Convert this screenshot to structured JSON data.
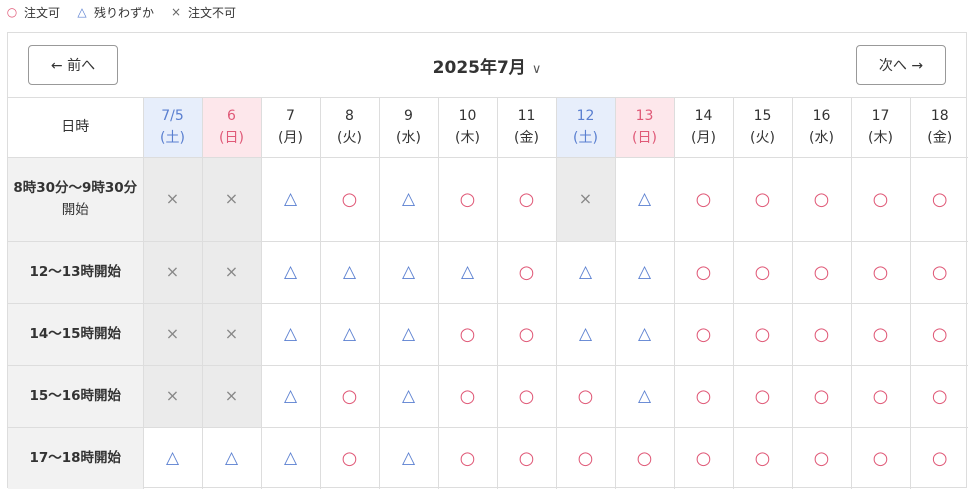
{
  "legend": [
    {
      "icon": "circle-icon",
      "symbol": "○",
      "label": "注文可",
      "kind": "ok"
    },
    {
      "icon": "triangle-icon",
      "symbol": "△",
      "label": "残りわずか",
      "kind": "few"
    },
    {
      "icon": "cross-icon",
      "symbol": "×",
      "label": "注文不可",
      "kind": "ng"
    }
  ],
  "header": {
    "prev_label": "← 前へ",
    "next_label": "次へ →",
    "month_label": "2025年7月",
    "month_chevron": "∨"
  },
  "corner_label": "日時",
  "days": [
    {
      "date": "7/5",
      "weekday": "(土)",
      "type": "sat"
    },
    {
      "date": "6",
      "weekday": "(日)",
      "type": "sun"
    },
    {
      "date": "7",
      "weekday": "(月)",
      "type": "weekday"
    },
    {
      "date": "8",
      "weekday": "(火)",
      "type": "weekday"
    },
    {
      "date": "9",
      "weekday": "(水)",
      "type": "weekday"
    },
    {
      "date": "10",
      "weekday": "(木)",
      "type": "weekday"
    },
    {
      "date": "11",
      "weekday": "(金)",
      "type": "weekday"
    },
    {
      "date": "12",
      "weekday": "(土)",
      "type": "sat"
    },
    {
      "date": "13",
      "weekday": "(日)",
      "type": "sun"
    },
    {
      "date": "14",
      "weekday": "(月)",
      "type": "weekday"
    },
    {
      "date": "15",
      "weekday": "(火)",
      "type": "weekday"
    },
    {
      "date": "16",
      "weekday": "(水)",
      "type": "weekday"
    },
    {
      "date": "17",
      "weekday": "(木)",
      "type": "weekday"
    },
    {
      "date": "18",
      "weekday": "(金)",
      "type": "weekday"
    }
  ],
  "slots": [
    {
      "label_main": "8時30分〜9時30分",
      "label_sub": "開始",
      "status": [
        "ng",
        "ng",
        "few",
        "ok",
        "few",
        "ok",
        "ok",
        "ng",
        "few",
        "ok",
        "ok",
        "ok",
        "ok",
        "ok"
      ]
    },
    {
      "label_main": "12〜13時開始",
      "label_sub": "",
      "status": [
        "ng",
        "ng",
        "few",
        "few",
        "few",
        "few",
        "ok",
        "few",
        "few",
        "ok",
        "ok",
        "ok",
        "ok",
        "ok"
      ]
    },
    {
      "label_main": "14〜15時開始",
      "label_sub": "",
      "status": [
        "ng",
        "ng",
        "few",
        "few",
        "few",
        "ok",
        "ok",
        "few",
        "few",
        "ok",
        "ok",
        "ok",
        "ok",
        "ok"
      ]
    },
    {
      "label_main": "15〜16時開始",
      "label_sub": "",
      "status": [
        "ng",
        "ng",
        "few",
        "ok",
        "few",
        "ok",
        "ok",
        "ok",
        "few",
        "ok",
        "ok",
        "ok",
        "ok",
        "ok"
      ]
    },
    {
      "label_main": "17〜18時開始",
      "label_sub": "",
      "status": [
        "few",
        "few",
        "few",
        "ok",
        "few",
        "ok",
        "ok",
        "ok",
        "ok",
        "ok",
        "ok",
        "ok",
        "ok",
        "ok"
      ]
    }
  ],
  "symbols": {
    "ok": "○",
    "few": "△",
    "ng": "×"
  },
  "colors": {
    "ok": "#e05a78",
    "few": "#5a7fd0",
    "ng": "#888888",
    "saturday_bg": "#e7eefb",
    "sunday_bg": "#fde7eb",
    "closed_bg": "#ebebeb"
  }
}
